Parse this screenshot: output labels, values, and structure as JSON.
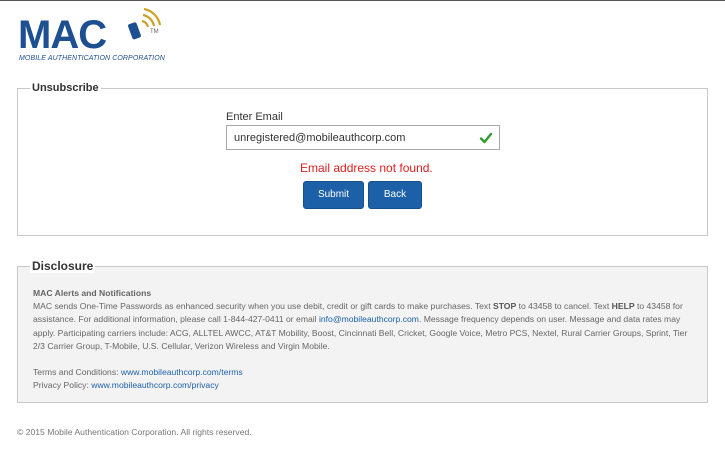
{
  "brand": {
    "name": "MAC",
    "trademark": "TM",
    "tagline": "MOBILE AUTHENTICATION CORPORATION"
  },
  "unsubscribe": {
    "legend": "Unsubscribe",
    "email_label": "Enter Email",
    "email_value": "unregistered@mobileauthcorp.com",
    "error": "Email address not found.",
    "submit_label": "Submit",
    "back_label": "Back"
  },
  "disclosure": {
    "legend": "Disclosure",
    "title": "MAC Alerts and Notifications",
    "p1_a": "MAC sends One-Time Passwords as enhanced security when you use debit, credit or gift cards to make purchases. Text ",
    "p1_stop": "STOP",
    "p1_b": " to 43458 to cancel. Text ",
    "p1_help": "HELP",
    "p1_c": " to 43458 for assistance. For additional information, please call 1-844-427-0411 or email ",
    "p1_email": "info@mobileauthcorp.com",
    "p1_d": ". Message frequency depends on user. Message and data rates may apply. Participating carriers include: ACG, ALLTEL AWCC, AT&T Mobility, Boost, Cincinnati Bell, Cricket, Google Voice, Metro PCS, Nextel, Rural Carrier Groups, Sprint, Tier 2/3 Carrier Group, T-Mobile, U.S. Cellular, Verizon Wireless and Virgin Mobile.",
    "terms_label": "Terms and Conditions: ",
    "terms_link": "www.mobileauthcorp.com/terms",
    "privacy_label": "Privacy Policy: ",
    "privacy_link": "www.mobileauthcorp.com/privacy"
  },
  "footer": {
    "copyright": "© 2015 Mobile Authentication Corporation. All rights reserved."
  },
  "colors": {
    "brand_blue": "#1d4f91",
    "button_blue": "#1c61a8",
    "error_red": "#e02020",
    "check_green": "#2e9e2e",
    "signal_gold": "#c9a227"
  },
  "icons": {
    "logo_signal": "signal-waves-icon",
    "valid": "checkmark-icon"
  }
}
